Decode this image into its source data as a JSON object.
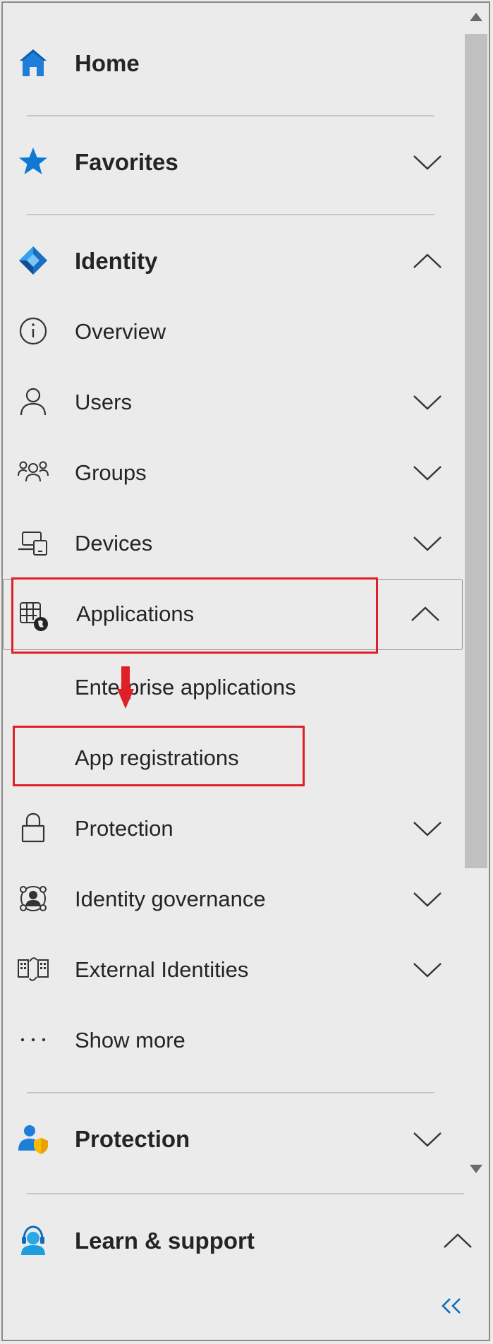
{
  "nav": {
    "home": {
      "label": "Home",
      "icon": "home-icon"
    },
    "favorites": {
      "label": "Favorites",
      "icon": "star-icon"
    },
    "identity": {
      "label": "Identity",
      "icon": "identity-diamond-icon"
    },
    "identity_items": [
      {
        "label": "Overview",
        "icon": "info-icon"
      },
      {
        "label": "Users",
        "icon": "user-icon"
      },
      {
        "label": "Groups",
        "icon": "groups-icon"
      },
      {
        "label": "Devices",
        "icon": "devices-icon"
      },
      {
        "label": "Applications",
        "icon": "applications-icon"
      },
      {
        "label": "Enterprise applications"
      },
      {
        "label": "App registrations"
      },
      {
        "label": "Protection",
        "icon": "lock-icon"
      },
      {
        "label": "Identity governance",
        "icon": "governance-icon"
      },
      {
        "label": "External Identities",
        "icon": "external-identities-icon"
      },
      {
        "label": "Show more",
        "icon": "ellipsis-icon"
      }
    ],
    "protection": {
      "label": "Protection",
      "icon": "protection-user-shield-icon"
    },
    "learn": {
      "label": "Learn & support",
      "icon": "support-person-icon"
    },
    "collapse": {
      "label": "«"
    }
  },
  "colors": {
    "accent": "#0f6cbd",
    "highlight": "#e02027",
    "background": "#ebebeb"
  }
}
